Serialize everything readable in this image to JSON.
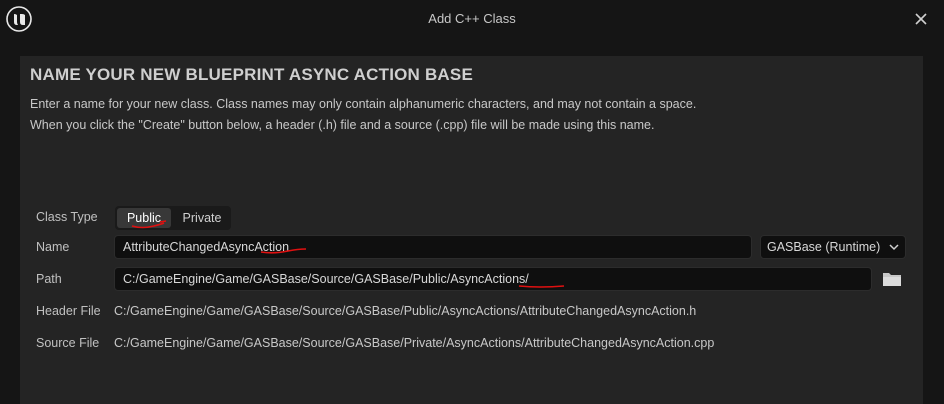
{
  "window": {
    "title": "Add C++ Class",
    "logo_icon": "unreal-engine-logo",
    "close_icon": "close-icon"
  },
  "panel": {
    "heading": "NAME YOUR NEW BLUEPRINT ASYNC ACTION BASE",
    "description_line1": "Enter a name for your new class. Class names may only contain alphanumeric characters, and may not contain a space.",
    "description_line2": "When you click the \"Create\" button below, a header (.h) file and a source (.cpp) file will be made using this name."
  },
  "form": {
    "class_type_label": "Class Type",
    "class_type_options": [
      "Public",
      "Private"
    ],
    "class_type_selected": "Public",
    "name_label": "Name",
    "name_value": "AttributeChangedAsyncAction",
    "module_dropdown": "GASBase (Runtime)",
    "path_label": "Path",
    "path_value": "C:/GameEngine/Game/GASBase/Source/GASBase/Public/AsyncActions/",
    "header_file_label": "Header File",
    "header_file_value": "C:/GameEngine/Game/GASBase/Source/GASBase/Public/AsyncActions/AttributeChangedAsyncAction.h",
    "source_file_label": "Source File",
    "source_file_value": "C:/GameEngine/Game/GASBase/Source/GASBase/Private/AsyncActions/AttributeChangedAsyncAction.cpp"
  },
  "colors": {
    "background": "#151515",
    "panel": "#242424",
    "input": "#0f0f0f",
    "annotation_red": "#e01010"
  }
}
